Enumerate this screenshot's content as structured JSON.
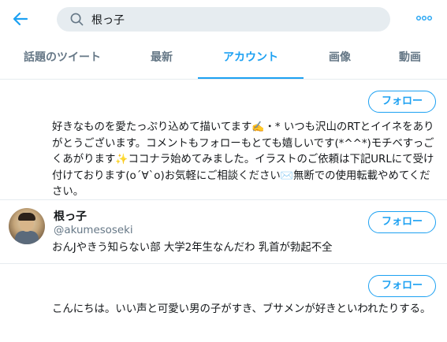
{
  "search": {
    "query": "根っ子"
  },
  "tabs": [
    {
      "label": "話題のツイート"
    },
    {
      "label": "最新"
    },
    {
      "label": "アカウント"
    },
    {
      "label": "画像"
    },
    {
      "label": "動画"
    }
  ],
  "results": [
    {
      "follow_label": "フォロー",
      "bio_1": "好きなものを愛たっぷり込めて描いてます",
      "bio_2": "・* いつも沢山のRTとイイネをありがとうございます。コメントもフォローもとても嬉しいです(*^^*)モチベすっごくあがります",
      "bio_3": "ココナラ始めてみました。イラストのご依頼は下記URLにて受け付けております(o´∀`o)お気軽にご相談ください",
      "bio_4": "無断での使用転載やめてください。"
    },
    {
      "follow_label": "フォロー",
      "name": "根っ子",
      "handle": "@akumesoseki",
      "bio": "おんJやきう知らない部 大学2年生なんだわ 乳首が勃起不全"
    },
    {
      "follow_label": "フォロー",
      "bio": "こんにちは。いい声と可愛い男の子がすき、ブサメンが好きといわれたりする。"
    }
  ],
  "colors": {
    "accent": "#1da1f2",
    "text": "#14171a",
    "muted": "#657786",
    "divider": "#e6ecf0",
    "search_bg": "#e6ecf0"
  },
  "icons": [
    "back-arrow-icon",
    "search-icon",
    "more-options-icon",
    "writing-hand-emoji",
    "sparkles-emoji",
    "envelope-emoji"
  ]
}
